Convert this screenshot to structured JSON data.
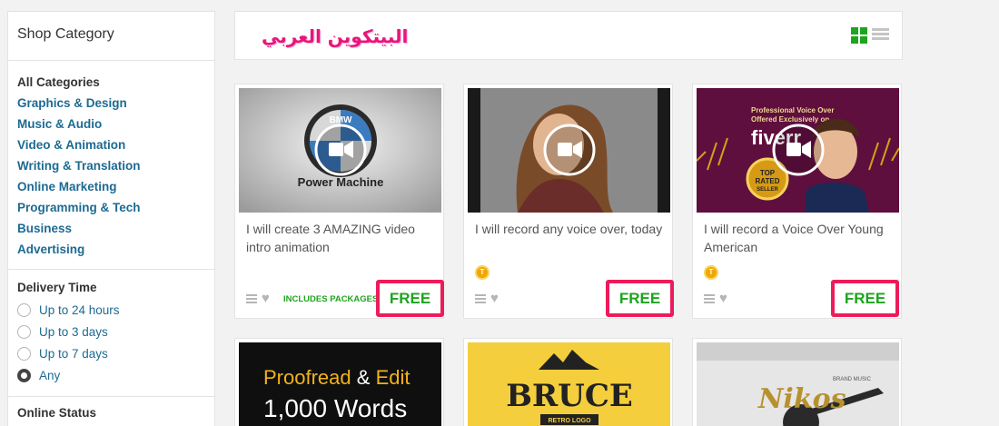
{
  "sidebar": {
    "title": "Shop Category",
    "categories": [
      "All Categories",
      "Graphics & Design",
      "Music & Audio",
      "Video & Animation",
      "Writing & Translation",
      "Online Marketing",
      "Programming & Tech",
      "Business",
      "Advertising"
    ],
    "delivery": {
      "heading": "Delivery Time",
      "options": [
        "Up to 24 hours",
        "Up to 3 days",
        "Up to 7 days",
        "Any"
      ],
      "selected": "Any"
    },
    "online_status": {
      "heading": "Online Status"
    }
  },
  "header": {
    "watermark": "البيتكوين العربي",
    "view_icons": [
      "grid-view-icon",
      "list-view-icon"
    ]
  },
  "gigs": [
    {
      "title": "I will create 3 AMAZING video intro animation",
      "thumb_caption": "Power Machine",
      "thumb_logo": "BMW",
      "tag": "INCLUDES PACKAGES",
      "price": "FREE",
      "top_rated": false
    },
    {
      "title": "I will record any voice over, today",
      "price": "FREE",
      "top_rated": true,
      "badge_letter": "T"
    },
    {
      "title": "I will record a Voice Over Young American",
      "thumb_text": [
        "Professional Voice Over",
        "Offered Exclusively on",
        "fiverr",
        "TOP",
        "RATED",
        "SELLER"
      ],
      "price": "FREE",
      "top_rated": true,
      "badge_letter": "T"
    }
  ],
  "gigs_row2": [
    {
      "thumb_text": [
        "Proofread",
        "&",
        "Edit",
        "1,000 Words"
      ]
    },
    {
      "thumb_text": [
        "BRUCE",
        "RETRO LOGO"
      ]
    },
    {
      "thumb_text": [
        "Nikos",
        "BRAND MUSIC"
      ]
    }
  ],
  "colors": {
    "accent_green": "#1ea41e",
    "link_blue": "#1d6a92",
    "highlight_pink": "#ec1c5a",
    "badge_gold": "#f0a800"
  }
}
